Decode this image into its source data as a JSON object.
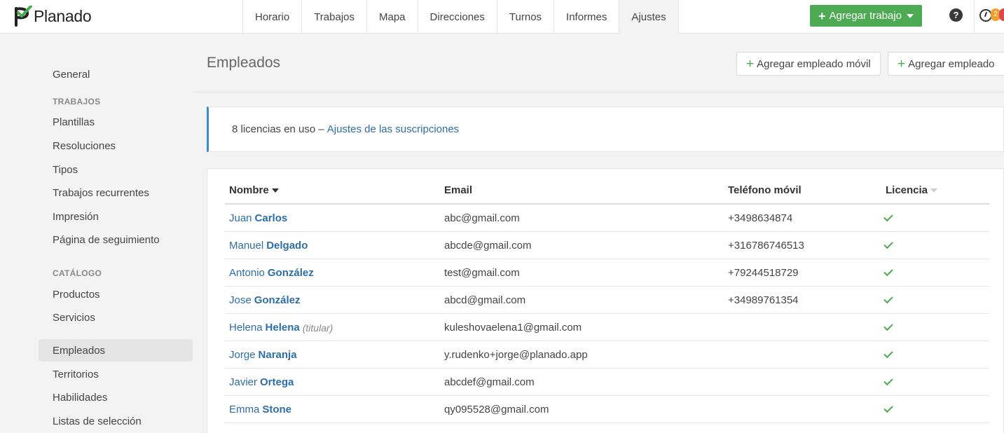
{
  "brand": {
    "name": "Planado",
    "color": "#4caa52"
  },
  "nav": {
    "items": [
      {
        "label": "Horario"
      },
      {
        "label": "Trabajos"
      },
      {
        "label": "Mapa"
      },
      {
        "label": "Direcciones"
      },
      {
        "label": "Turnos"
      },
      {
        "label": "Informes"
      },
      {
        "label": "Ajustes",
        "active": true
      }
    ],
    "add_job_label": "Agregar trabajo",
    "help_label": "?",
    "badge_orange": "2"
  },
  "sidebar": {
    "general": "General",
    "section_trabajos": "TRABAJOS",
    "plantillas": "Plantillas",
    "resoluciones": "Resoluciones",
    "tipos": "Tipos",
    "recurrentes": "Trabajos recurrentes",
    "impresion": "Impresión",
    "seguimiento": "Página de seguimiento",
    "section_catalogo": "CATÁLOGO",
    "productos": "Productos",
    "servicios": "Servicios",
    "empleados": "Empleados",
    "territorios": "Territorios",
    "habilidades": "Habilidades",
    "listas": "Listas de selección"
  },
  "main": {
    "title": "Empleados",
    "add_mobile_label": "Agregar empleado móvil",
    "add_employee_label": "Agregar empleado",
    "license_text": "8 licencias en uso –",
    "license_link": "Ajustes de las suscripciones"
  },
  "table": {
    "headers": {
      "name": "Nombre",
      "email": "Email",
      "phone": "Teléfono móvil",
      "license": "Licencia"
    },
    "rows": [
      {
        "first": "Juan",
        "last": "Carlos",
        "note": "",
        "email": "abc@gmail.com",
        "phone": "+3498634874",
        "license": true
      },
      {
        "first": "Manuel",
        "last": "Delgado",
        "note": "",
        "email": "abcde@gmail.com",
        "phone": "+316786746513",
        "license": true
      },
      {
        "first": "Antonio",
        "last": "González",
        "note": "",
        "email": "test@gmail.com",
        "phone": "+79244518729",
        "license": true
      },
      {
        "first": "Jose",
        "last": "González",
        "note": "",
        "email": "abcd@gmail.com",
        "phone": "+34989761354",
        "license": true
      },
      {
        "first": "Helena",
        "last": "Helena",
        "note": "(titular)",
        "email": "kuleshovaelena1@gmail.com",
        "phone": "",
        "license": true
      },
      {
        "first": "Jorge",
        "last": "Naranja",
        "note": "",
        "email": "y.rudenko+jorge@planado.app",
        "phone": "",
        "license": true
      },
      {
        "first": "Javier",
        "last": "Ortega",
        "note": "",
        "email": "abcdef@gmail.com",
        "phone": "",
        "license": true
      },
      {
        "first": "Emma",
        "last": "Stone",
        "note": "",
        "email": "qy095528@gmail.com",
        "phone": "",
        "license": true
      }
    ]
  }
}
